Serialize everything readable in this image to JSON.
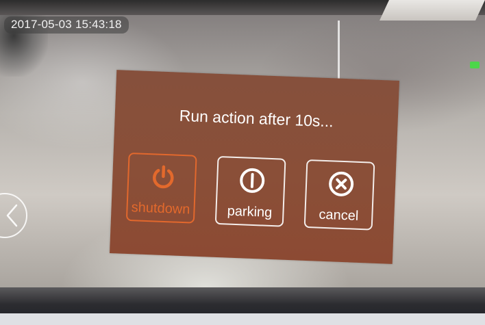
{
  "timestamp": "2017-05-03 15:43:18",
  "dialog": {
    "title": "Run action after 10s...",
    "buttons": [
      {
        "label": "shutdown",
        "icon": "power-icon",
        "selected": true
      },
      {
        "label": "parking",
        "icon": "parking-icon",
        "selected": false
      },
      {
        "label": "cancel",
        "icon": "close-icon",
        "selected": false
      }
    ]
  },
  "colors": {
    "dialog_background": "#8a4f38",
    "accent": "#e2682d",
    "status_led": "#4cd64a"
  },
  "nav": {
    "back_icon": "chevron-left-icon"
  }
}
